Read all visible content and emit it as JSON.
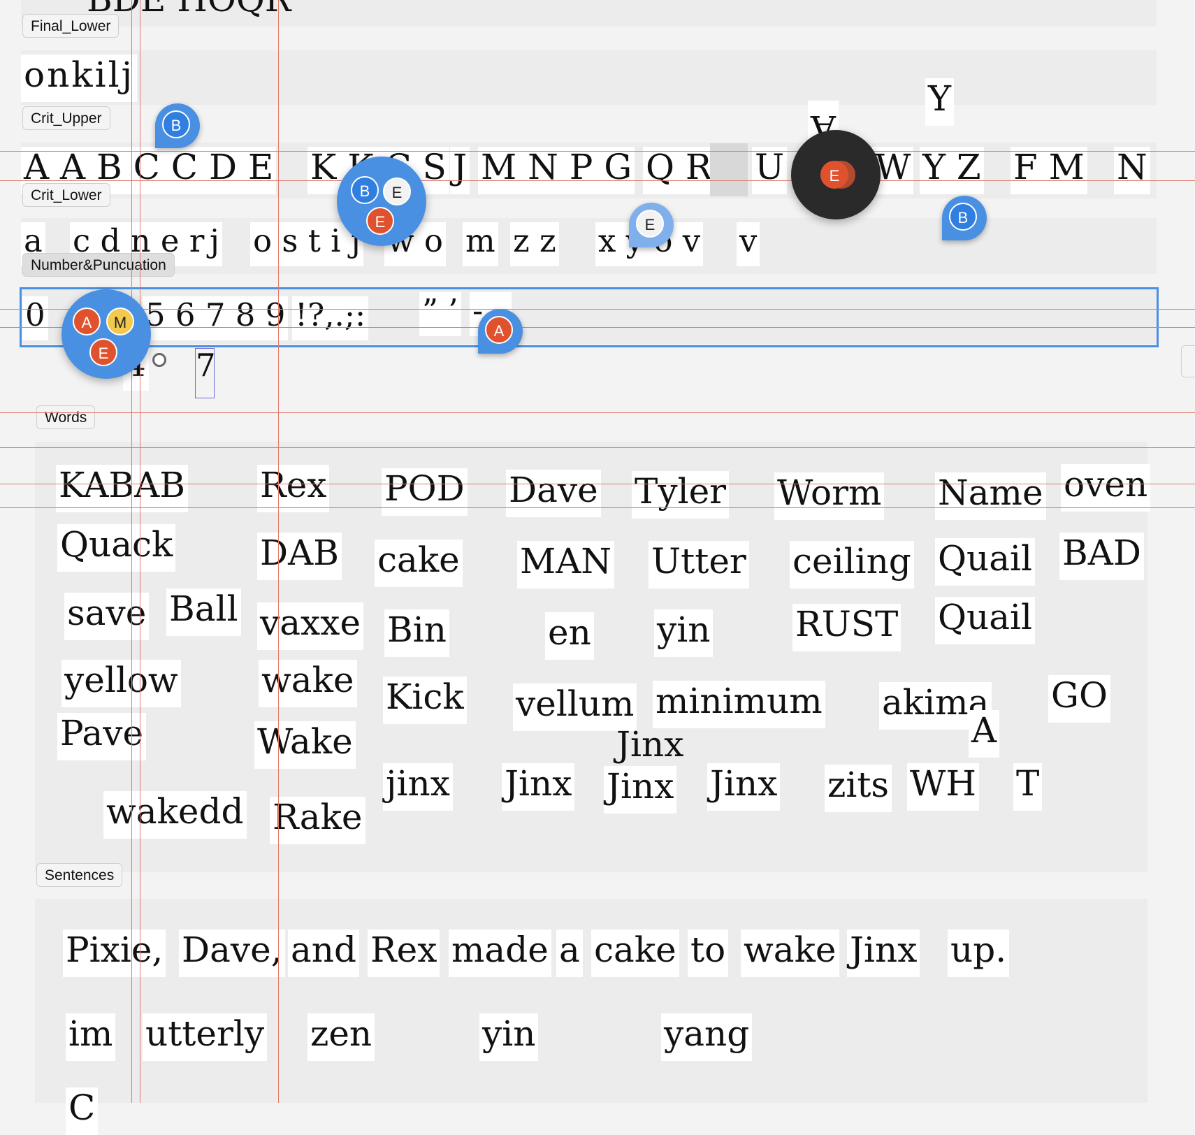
{
  "frames": {
    "final_lower": "Final_Lower",
    "crit_upper": "Crit_Upper",
    "crit_lower": "Crit_Lower",
    "number_punctuation": "Number&Puncuation",
    "words": "Words",
    "sentences": "Sentences"
  },
  "top_cut_text": "BDE HOQR",
  "final_lower_row": "onkilj",
  "crit_upper_row": [
    "A A B C C D E",
    "K K C S",
    "J",
    "M N P G",
    "Q R",
    "U",
    "W",
    "Y Z",
    "F M",
    "N"
  ],
  "floating_upper": [
    "A",
    "Y"
  ],
  "crit_lower_row": [
    "a",
    "c d n e r",
    "j",
    "o s t i j",
    "w o",
    "m",
    "z z",
    "x y o v",
    "v"
  ],
  "number_row": [
    "0",
    "5 6 7 8 9",
    "!?,.;:",
    "” ’",
    "- –"
  ],
  "number_extra": [
    "4",
    "7"
  ],
  "words": [
    "KABAB",
    "Rex",
    "POD",
    "Dave",
    "Tyler",
    "Worm",
    "Name",
    "oven",
    "Quack",
    "DAB",
    "cake",
    "MAN",
    "Utter",
    "ceiling",
    "Quail",
    "BAD",
    "save",
    "Ball",
    "vaxxe",
    "Bin",
    "en",
    "yin",
    "RUST",
    "Quail",
    "yellow",
    "wake",
    "Kick",
    "vellum",
    "minimum",
    "akima",
    "GO",
    "Pave",
    "Wake",
    "Jinx",
    "A",
    "jinx",
    "Jinx",
    "Jinx",
    "Jinx",
    "zits",
    "WH",
    "T",
    "wakedd",
    "Rake"
  ],
  "sentences": {
    "line1": [
      "Pixie,",
      "Dave,",
      "and",
      "Rex",
      "made",
      "a",
      "cake",
      "to",
      "wake",
      "Jinx",
      "up."
    ],
    "line2": [
      "im",
      "utterly",
      "zen",
      "yin",
      "yang"
    ],
    "line3": "C"
  },
  "collaborators": {
    "pin_crit_upper": "B",
    "cluster_upper": [
      "B",
      "E",
      "E"
    ],
    "dark_cluster": "E",
    "pin_e_lower": "E",
    "pin_b_right": "B",
    "cluster_numbers": [
      "A",
      "M",
      "E"
    ],
    "pin_a_numbers": "A"
  },
  "colors": {
    "selection": "#4a90e2",
    "guide": "#e07b6e",
    "avatar_red": "#e0522e",
    "avatar_blue": "#2f7ee0",
    "avatar_yellow": "#f2c94c"
  }
}
